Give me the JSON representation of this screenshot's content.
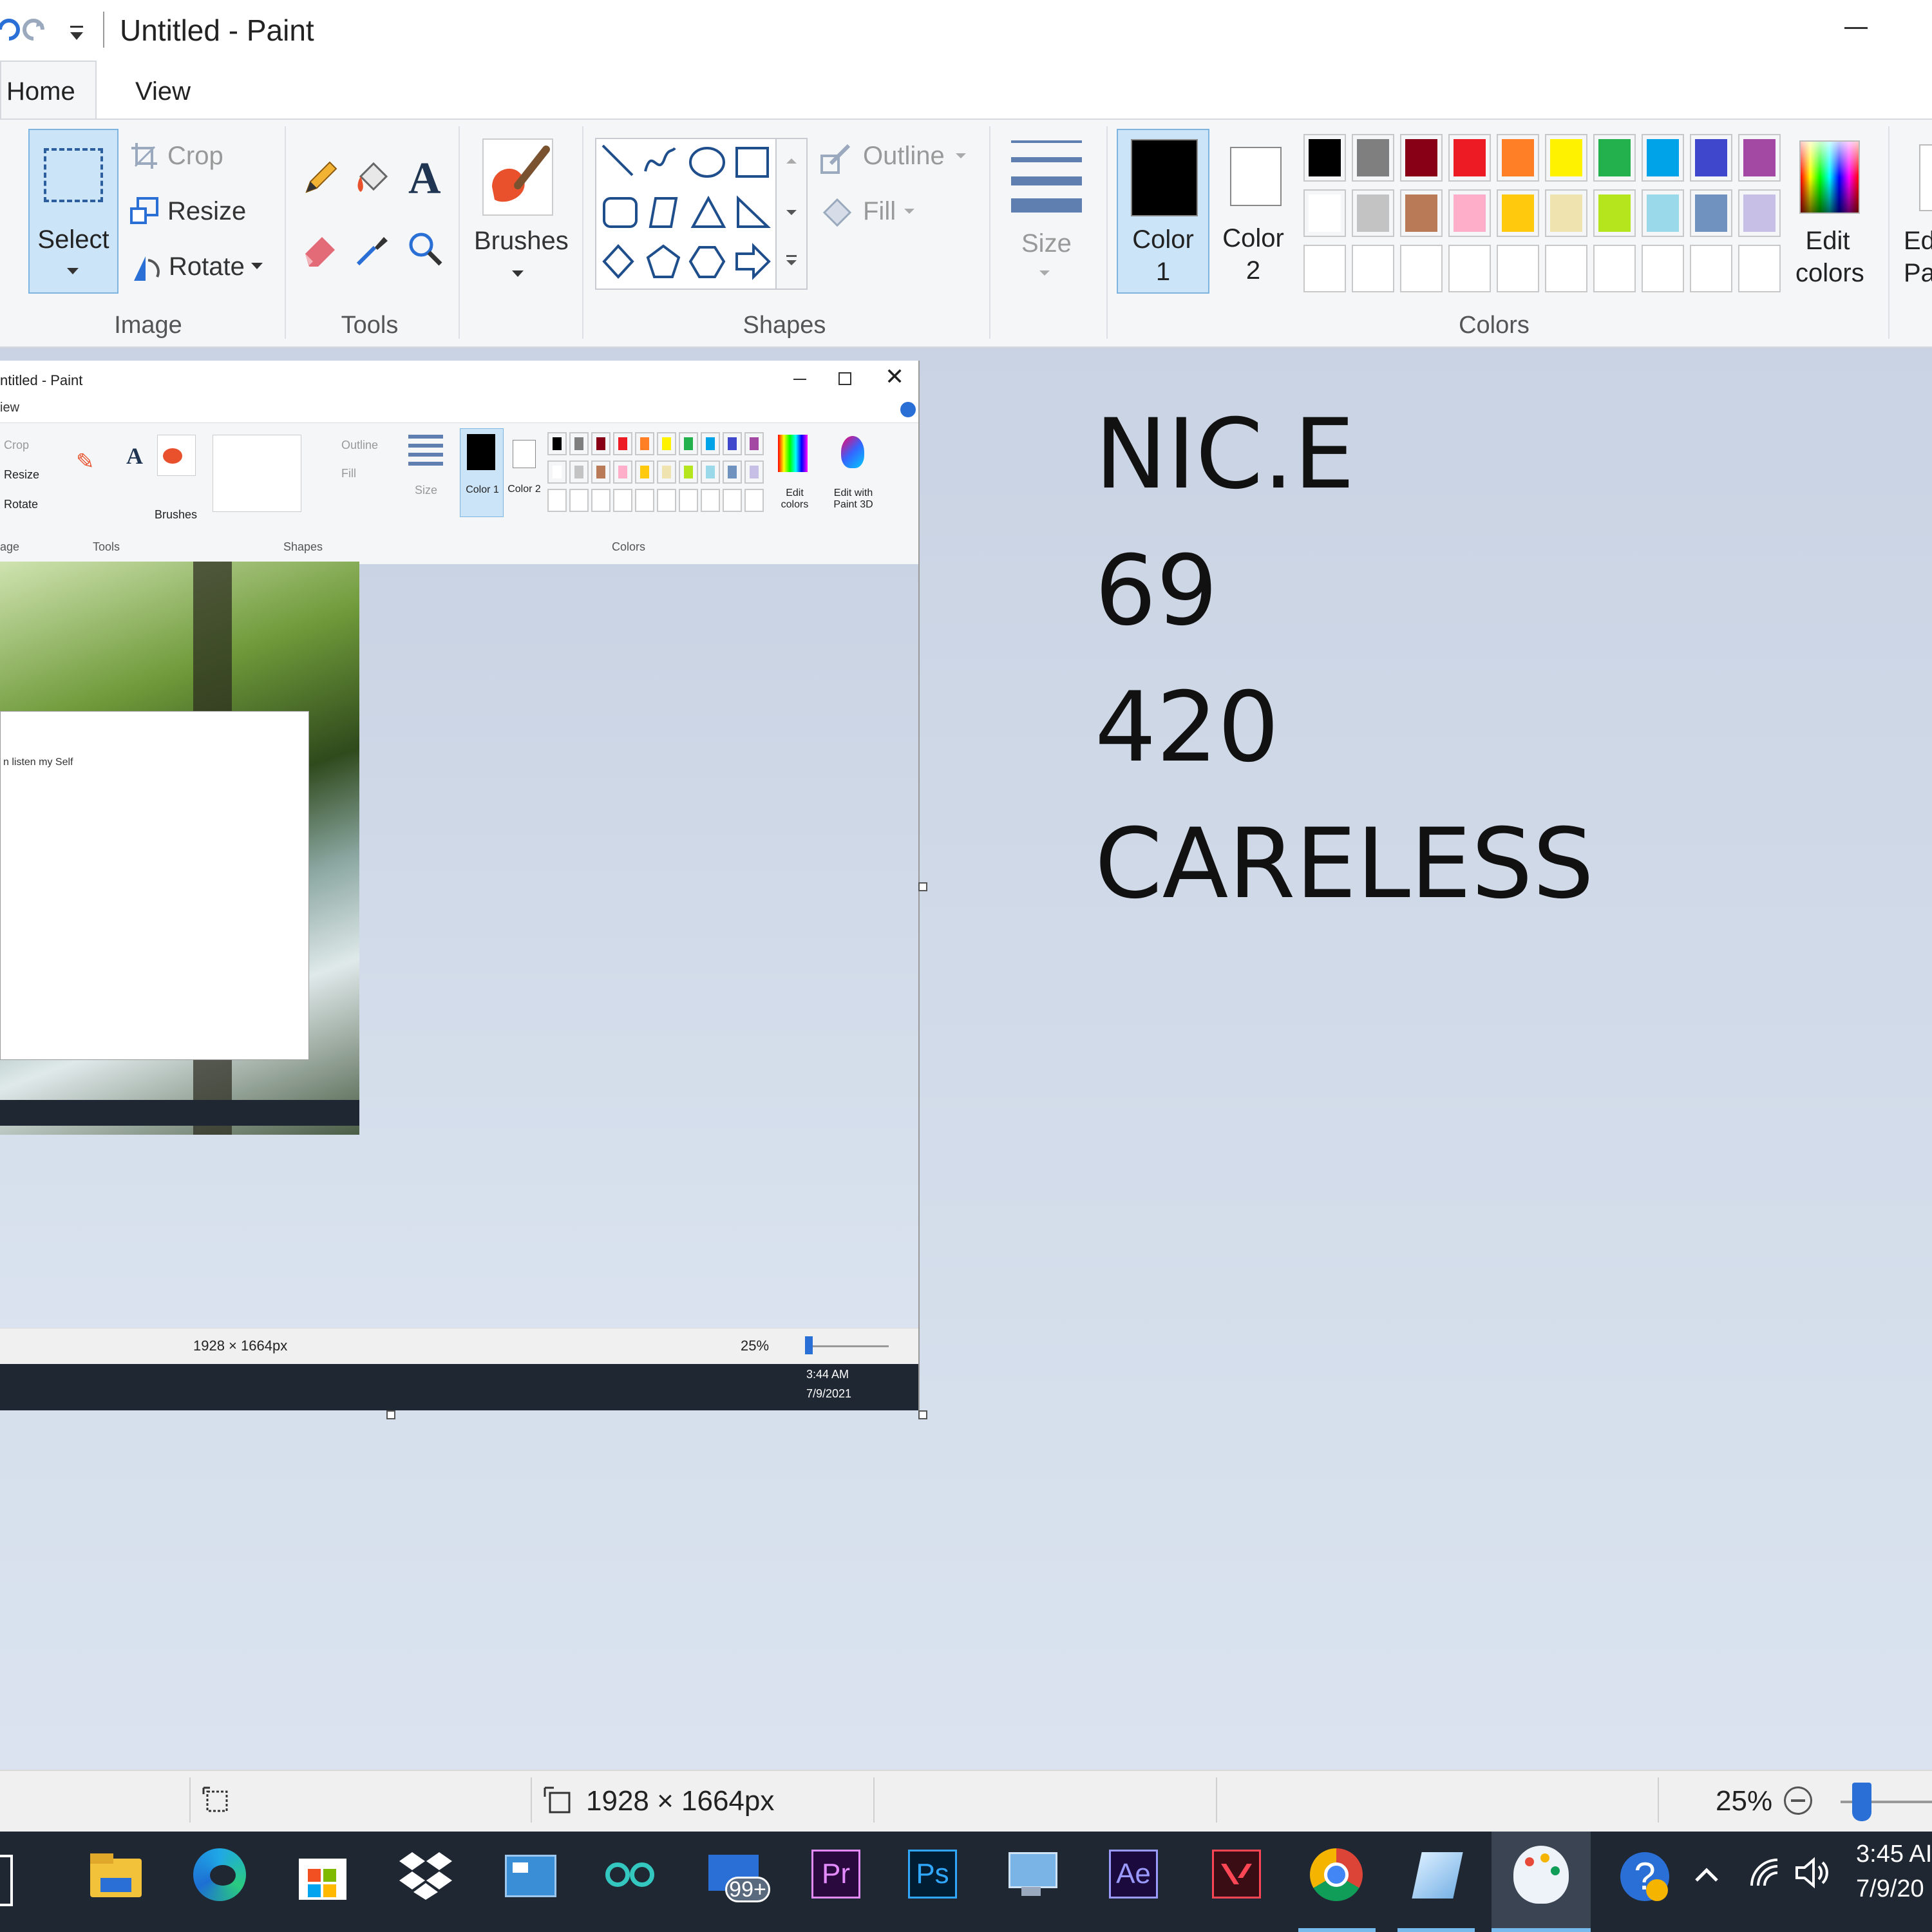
{
  "window": {
    "title": "Untitled - Paint",
    "min_glyph": "—"
  },
  "tabs": [
    "Home",
    "View"
  ],
  "ribbon": {
    "image": {
      "label": "Image",
      "select": "Select",
      "crop": "Crop",
      "resize": "Resize",
      "rotate": "Rotate"
    },
    "tools": {
      "label": "Tools"
    },
    "brushes": "Brushes",
    "shapes": {
      "label": "Shapes",
      "outline": "Outline",
      "fill": "Fill"
    },
    "size": "Size",
    "colors": {
      "label": "Colors",
      "color1_a": "Color",
      "color1_b": "1",
      "color2_a": "Color",
      "color2_b": "2",
      "edit_a": "Edit",
      "edit_b": "colors",
      "edit3d_a": "Ed",
      "edit3d_b": "Pa",
      "palette_row1": [
        "#000000",
        "#7f7f7f",
        "#880015",
        "#ed1c24",
        "#ff7f27",
        "#fff200",
        "#22b14c",
        "#00a2e8",
        "#3f48cc",
        "#a349a4"
      ],
      "palette_row2": [
        "#ffffff",
        "#c3c3c3",
        "#b97a57",
        "#ffaec9",
        "#ffc90e",
        "#efe4b0",
        "#b5e61d",
        "#99d9ea",
        "#7092be",
        "#c8bfe7"
      ]
    }
  },
  "canvas": {
    "lines": [
      "NIC.E",
      "69",
      "420",
      "CARELESS"
    ]
  },
  "pasted": {
    "title": "ntitled - Paint",
    "view": "iew",
    "crop": "Crop",
    "resize": "Resize",
    "rotate": "Rotate",
    "brushes": "Brushes",
    "outline": "Outline",
    "fill": "Fill",
    "size": "Size",
    "color1": "Color 1",
    "color2": "Color 2",
    "edit_colors": "Edit colors",
    "edit3d": "Edit with Paint 3D",
    "g_image": "age",
    "g_tools": "Tools",
    "g_shapes": "Shapes",
    "g_colors": "Colors",
    "status_dims": "1928 × 1664px",
    "zoom": "25%",
    "time": "3:44 AM",
    "date": "7/9/2021",
    "inner_text": "n listen my Self"
  },
  "status": {
    "dims": "1928 × 1664px",
    "zoom": "25%"
  },
  "taskbar": {
    "badge": "99+",
    "time": "3:45 AI",
    "date": "7/9/20"
  }
}
